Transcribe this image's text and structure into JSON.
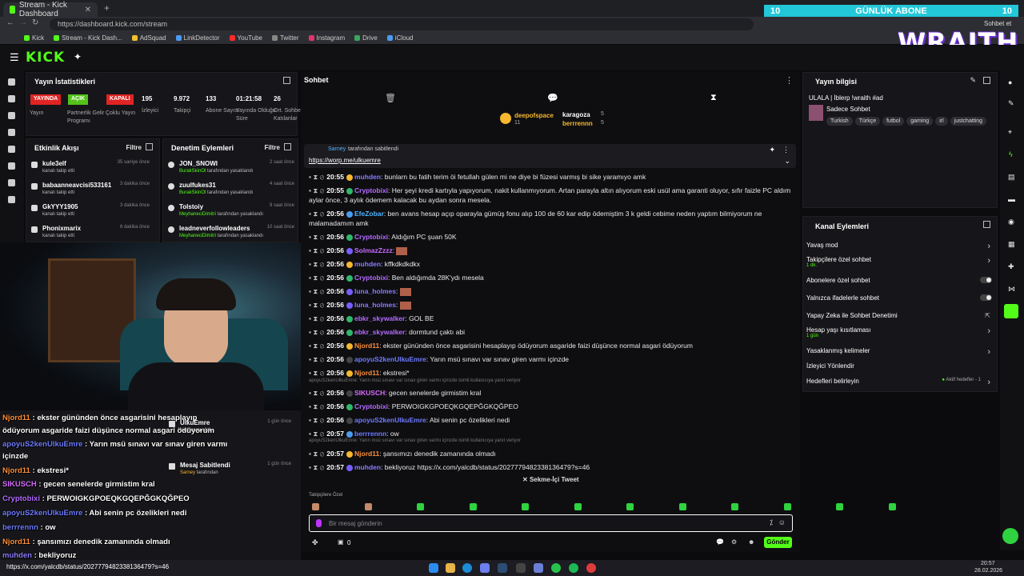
{
  "browser": {
    "tabs": [
      {
        "label": "Stream - Kick Dashboard"
      }
    ],
    "url": "https://dashboard.kick.com/stream",
    "bookmarks": [
      "Kick",
      "Stream - Kick Dash...",
      "AdSquad",
      "LinkDetector",
      "YouTube",
      "Twitter",
      "Instagram",
      "Drive",
      "iCloud"
    ],
    "profile_label": "Sohbet et"
  },
  "overlay": {
    "banner_left": "10",
    "banner_center": "GÜNLÜK ABONE",
    "banner_right": "10",
    "logo_text": "WRAITH"
  },
  "kick": {
    "logo": "KICK"
  },
  "stats": {
    "title": "Yayın İstatistikleri",
    "badges": [
      {
        "label": "YAYINDA",
        "color": "#e02424",
        "caption": "Yayın"
      },
      {
        "label": "AÇIK",
        "color": "#53c21a",
        "caption": "Partnerlik Gelir Programı"
      },
      {
        "label": "KAPALI",
        "color": "#e02424",
        "caption": "Çoklu Yayın"
      }
    ],
    "values": [
      {
        "value": "195",
        "caption": "İzleyici"
      },
      {
        "value": "9.972",
        "caption": "Takipçi"
      },
      {
        "value": "133",
        "caption": "Abone Sayısı"
      },
      {
        "value": "01:21:58",
        "caption": "Yayında Olduğu Süre"
      },
      {
        "value": "26",
        "caption": "Ort. Sohbete Katılanlar"
      }
    ]
  },
  "activity": {
    "title": "Etkinlik Akışı",
    "filter": "Filtre",
    "items": [
      {
        "name": "kule3elf",
        "sub": "kanalı takip etti",
        "time": "35 saniye önce"
      },
      {
        "name": "babaanneavcisi533161",
        "sub": "kanalı takip etti",
        "time": "3 dakika önce"
      },
      {
        "name": "GkYYY1905",
        "sub": "kanalı takip etti",
        "time": "3 dakika önce"
      },
      {
        "name": "Phonixmarix",
        "sub": "kanalı takip etti",
        "time": "6 dakika önce"
      }
    ]
  },
  "moderation": {
    "title": "Denetim Eylemleri",
    "filter": "Filtre",
    "items": [
      {
        "name": "JON_SNOWI",
        "by": "BurakSkinOl",
        "sub": "tarafından yasaklandı",
        "time": "2 saat önce"
      },
      {
        "name": "zuulfukes31",
        "by": "BurakSkinOl",
        "sub": "tarafından yasaklandı",
        "time": "4 saat önce"
      },
      {
        "name": "Tolstoiy",
        "by": "MeyhaneciDimitri",
        "sub": "tarafından yasaklandı",
        "time": "9 saat önce"
      },
      {
        "name": "leadneverfollowleaders",
        "by": "MeyhaneciDimitri",
        "sub": "tarafından yasaklandı",
        "time": "10 saat önce"
      }
    ],
    "extra": [
      {
        "name": "UlkuEmre",
        "sub": "bir mesajı sildi",
        "time": "1 gün önce"
      },
      {
        "name": "Mesaj Sabitlendi",
        "by": "Sarney",
        "sub": "tarafından",
        "time": "1 gün önce"
      }
    ]
  },
  "chat": {
    "title": "Sohbet",
    "top_users": [
      {
        "name": "deepofspace",
        "num": "11"
      },
      {
        "name": "karagoza",
        "num": "5"
      },
      {
        "name": "berrrennn",
        "num": "5"
      }
    ],
    "pinned": {
      "by": "Sarney",
      "note": "tarafından sabitlendi",
      "link": "https://worp.me/ulkuemre"
    },
    "messages": [
      {
        "time": "20:55",
        "user": "muhden",
        "color": "#8a7bff",
        "text": "bunlarn bu fatih terim öi fetullah gülen mi ne diye bi füzesi varmış bi sike yaramıyo amk"
      },
      {
        "time": "20:55",
        "user": "Cryptobixi",
        "color": "#b56cff",
        "text": "Her şeyi kredi kartıyla yapıyorum, nakit kullanmıyorum. Artan parayla altın alıyorum eski usül ama garanti oluyor, sıfır faizle PC aldım aylar önce, 3 aylık ödemem kalacak bu aydan sonra mesela."
      },
      {
        "time": "20:56",
        "user": "EfeZobar",
        "color": "#4fb4ff",
        "text": "ben avans hesap açıp oparayla gümüş fonu alıp 100 de 60 kar edip ödemiştim 3 k geldi cebime neden yaptım bilmiyorum ne malamadamım amk"
      },
      {
        "time": "20:56",
        "user": "Cryptobixi",
        "color": "#b56cff",
        "text": "Aldığım PC şuan 50K"
      },
      {
        "time": "20:56",
        "user": "SolmazZzzz",
        "color": "#c86cff",
        "text": ""
      },
      {
        "time": "20:56",
        "user": "muhden",
        "color": "#8a7bff",
        "text": "kffkdkdkdkx"
      },
      {
        "time": "20:56",
        "user": "Cryptobixi",
        "color": "#b56cff",
        "text": "Ben aldığımda 28K'ydı mesela"
      },
      {
        "time": "20:56",
        "user": "luna_holmes",
        "color": "#8a7bff",
        "text": ""
      },
      {
        "time": "20:56",
        "user": "luna_holmes",
        "color": "#8a7bff",
        "text": ""
      },
      {
        "time": "20:56",
        "user": "ebkr_skywalker",
        "color": "#b56cff",
        "text": "GOL BE"
      },
      {
        "time": "20:56",
        "user": "ebkr_skywalker",
        "color": "#b56cff",
        "text": "dormtund çaktı abi"
      },
      {
        "time": "20:56",
        "user": "Njord11",
        "color": "#ff8f3a",
        "text": "ekster gününden önce asgarisini hesaplayıp ödüyorum asgaride faizi düşünce normal asgari ödüyorum"
      },
      {
        "time": "20:56",
        "user": "apoyuS2kenUlkuEmre",
        "color": "#6f7bff",
        "text": "Yarın msü sınavı var sınav giren varmı içinzde"
      },
      {
        "time": "20:56",
        "user": "Njord11",
        "color": "#ff8f3a",
        "text": "ekstresi*"
      },
      {
        "time": "20:56",
        "user": "SIKUSCH",
        "color": "#d76cff",
        "text": "gecen senelerde girmistim kral"
      },
      {
        "time": "20:56",
        "user": "Cryptobixi",
        "color": "#b56cff",
        "text": "PERWOIGKGPOEQKGQEPĞGKQĞPEO"
      },
      {
        "time": "20:56",
        "user": "apoyuS2kenUlkuEmre",
        "color": "#6f7bff",
        "text": "Abi senin pc özelikleri nedi"
      },
      {
        "time": "20:57",
        "user": "berrrennn",
        "color": "#6f7bff",
        "text": "ow"
      },
      {
        "time": "20:57",
        "user": "Njord11",
        "color": "#ff8f3a",
        "text": "şansımızı denedik zamanında olmadı"
      },
      {
        "time": "20:57",
        "user": "muhden",
        "color": "#8a7bff",
        "text": "bekliyoruz https://x.com/yalcdb/status/2027779482338136479?s=46"
      }
    ],
    "reply_hints": [
      "apoyuS2kenUlkuEmre: Yarın msü sınavı var sınav giren varmı içinzde isimli kullanıcıya yanıt veriyor",
      "apoyuS2kenUlkuEmre: Yarın msü sınavı var sınav giren varmı içinzde isimli kullanıcıya yanıt veriyor"
    ],
    "tweet_label": "Sekme-İçi Tweet",
    "emote_label": "Takipçilere Özel",
    "input_placeholder": "Bir mesaj gönderin",
    "points": "0",
    "send_label": "Gönder"
  },
  "stream_info": {
    "title": "Yayın bilgisi",
    "stream_title": "ULALA | İblerp !wraith #ad",
    "category": "Sadece Sohbet",
    "tags": [
      "Turkish",
      "Türkçe",
      "futbol",
      "gaming",
      "irl",
      "justchatting"
    ]
  },
  "channel_actions": {
    "title": "Kanal Eylemleri",
    "items": [
      {
        "label": "Yavaş mod",
        "sub": "",
        "control": "chevron"
      },
      {
        "label": "Takipçilere özel sohbet",
        "sub": "1 dk.",
        "control": "chevron"
      },
      {
        "label": "Abonelere özel sohbet",
        "sub": "",
        "control": "toggle"
      },
      {
        "label": "Yalnızca ifadelerle sohbet",
        "sub": "",
        "control": "toggle"
      },
      {
        "label": "Yapay Zeka ile Sohbet Denetimi",
        "sub": "",
        "control": "external"
      },
      {
        "label": "Hesap yaşı kısıtlaması",
        "sub": "1 gün",
        "control": "chevron"
      },
      {
        "label": "Yasaklanmış kelimeler",
        "sub": "",
        "control": "chevron"
      },
      {
        "label": "İzleyici Yönlendir",
        "sub": "",
        "control": "none"
      },
      {
        "label": "Hedefleri belirleyin",
        "sub": "",
        "control": "goal",
        "extra": "Aktif hedefler - 1"
      }
    ]
  },
  "overlay_chat": [
    {
      "user": "Njord11",
      "color": "#ff8f3a",
      "text": "ekster gününden önce asgarisini hesaplayıp"
    },
    {
      "user": "",
      "color": "#fff",
      "text": "ödüyorum asgaride faizi düşünce normal asgari ödüyorum"
    },
    {
      "user": "apoyuS2kenUlkuEmre",
      "color": "#6f7bff",
      "text": "Yarın msü sınavı var sınav giren varmı"
    },
    {
      "user": "",
      "color": "#fff",
      "text": "içinzde"
    },
    {
      "user": "Njord11",
      "color": "#ff8f3a",
      "text": "ekstresi*"
    },
    {
      "user": "SIKUSCH",
      "color": "#d76cff",
      "text": "gecen senelerde girmistim kral"
    },
    {
      "user": "Cryptobixi",
      "color": "#b56cff",
      "text": "PERWOIGKGPOEQKGQEPĞGKQĞPEO"
    },
    {
      "user": "apoyuS2kenUlkuEmre",
      "color": "#6f7bff",
      "text": "Abi senin pc özelikleri nedi"
    },
    {
      "user": "berrrennn",
      "color": "#6f7bff",
      "text": "ow"
    },
    {
      "user": "Njord11",
      "color": "#ff8f3a",
      "text": "şansımızı denedik zamanında olmadı"
    },
    {
      "user": "muhden",
      "color": "#8a7bff",
      "text": "bekliyoruz"
    },
    {
      "user": "",
      "color": "#fff",
      "text": "https://x.com/yalcdb/status/2027779482338136479?s=46"
    }
  ],
  "taskbar": {
    "time": "20:57",
    "date": "28.02.2026"
  }
}
